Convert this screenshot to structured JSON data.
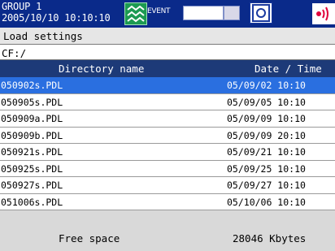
{
  "status_bar": {
    "group_label": "GROUP 1",
    "datetime": "2005/10/10 10:10:10",
    "event_label": "EVENT",
    "status_icon": "trend-display-icon",
    "disk_icon": "storage-media-icon",
    "alarm_icon": "sound-alarm-icon"
  },
  "dialog": {
    "title": "Load settings",
    "path": "CF:/"
  },
  "table": {
    "columns": [
      "Directory name",
      "Date / Time"
    ],
    "rows": [
      {
        "name": "050902s.PDL",
        "date": "05/09/02 10:10",
        "selected": true
      },
      {
        "name": "050905s.PDL",
        "date": "05/09/05 10:10",
        "selected": false
      },
      {
        "name": "050909a.PDL",
        "date": "05/09/09 10:10",
        "selected": false
      },
      {
        "name": "050909b.PDL",
        "date": "05/09/09 20:10",
        "selected": false
      },
      {
        "name": "050921s.PDL",
        "date": "05/09/21 10:10",
        "selected": false
      },
      {
        "name": "050925s.PDL",
        "date": "05/09/25 10:10",
        "selected": false
      },
      {
        "name": "050927s.PDL",
        "date": "05/09/27 10:10",
        "selected": false
      },
      {
        "name": "051006s.PDL",
        "date": "05/10/06 10:10",
        "selected": false
      }
    ]
  },
  "footer": {
    "free_space_label": "Free space",
    "free_space_value": "28046 Kbytes"
  },
  "colors": {
    "top_bar": "#0a2a8a",
    "table_header": "#1d3a78",
    "selection": "#2a6fe0",
    "status_icon_bg": "#1c9a52",
    "alarm_red": "#e0003a"
  }
}
